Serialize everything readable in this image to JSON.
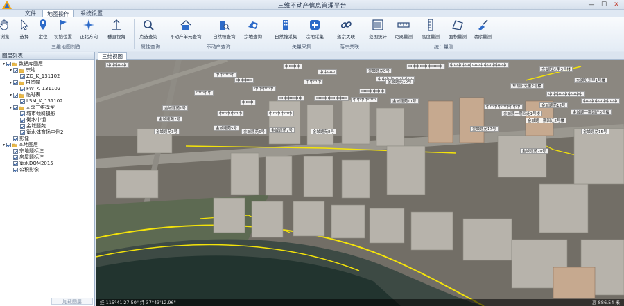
{
  "window": {
    "title": "三维不动产信息管理平台",
    "minimize": "—",
    "maximize": "☐",
    "close": "✕"
  },
  "menu": {
    "tabs": [
      "文件",
      "地图操作",
      "系统设置"
    ],
    "active": 1
  },
  "ribbon": {
    "groups": [
      {
        "label": "三维地图浏览",
        "buttons": [
          "浏览",
          "选择",
          "定位",
          "初始位置",
          "正北方向",
          "垂直视角"
        ]
      },
      {
        "label": "属性查询",
        "buttons": [
          "点选查询"
        ]
      },
      {
        "label": "不动产查询",
        "buttons": [
          "不动产单元查询",
          "自然幢查询",
          "宗地查询"
        ]
      },
      {
        "label": "矢量采集",
        "buttons": [
          "自然幢采集",
          "宗地采集"
        ]
      },
      {
        "label": "落宗关联",
        "buttons": [
          "落宗关联"
        ]
      },
      {
        "label": "统计量测",
        "buttons": [
          "范围统计",
          "距离量测",
          "高度量测",
          "面积量测",
          "清除量测"
        ]
      }
    ],
    "icons": [
      "hand-icon",
      "cursor-arrow-icon",
      "location-pin-icon",
      "flag-icon",
      "compass-icon",
      "vertical-view-icon",
      "magnifier-icon",
      "property-unit-icon",
      "building-search-icon",
      "parcel-search-icon",
      "building-capture-icon",
      "plus-capture-icon",
      "link-icon",
      "range-stat-icon",
      "distance-measure-icon",
      "height-measure-icon",
      "area-measure-icon",
      "clear-measure-icon"
    ]
  },
  "layer_panel": {
    "title": "图层列表",
    "tree": [
      {
        "label": "数据库图层",
        "level": 0,
        "expand": "▾",
        "checked": true,
        "icon": "folder"
      },
      {
        "label": "宗地",
        "level": 1,
        "expand": "▾",
        "checked": true,
        "icon": "folder"
      },
      {
        "label": "ZD_K_131102",
        "level": 2,
        "expand": "",
        "checked": true,
        "icon": ""
      },
      {
        "label": "自然幢",
        "level": 1,
        "expand": "▾",
        "checked": true,
        "icon": "folder"
      },
      {
        "label": "FW_K_131102",
        "level": 2,
        "expand": "",
        "checked": true,
        "icon": ""
      },
      {
        "label": "临时表",
        "level": 1,
        "expand": "▾",
        "checked": true,
        "icon": "folder"
      },
      {
        "label": "LSM_K_131102",
        "level": 2,
        "expand": "",
        "checked": true,
        "icon": ""
      },
      {
        "label": "天享三维模型",
        "level": 1,
        "expand": "▾",
        "checked": true,
        "icon": "folder"
      },
      {
        "label": "城市倾斜摄影",
        "level": 2,
        "expand": "",
        "checked": true,
        "icon": ""
      },
      {
        "label": "衡水中钢",
        "level": 2,
        "expand": "",
        "checked": true,
        "icon": ""
      },
      {
        "label": "金城题苑",
        "level": 2,
        "expand": "",
        "checked": true,
        "icon": ""
      },
      {
        "label": "衡水体育场中例2",
        "level": 2,
        "expand": "",
        "checked": true,
        "icon": ""
      },
      {
        "label": "影像",
        "level": 1,
        "expand": "",
        "checked": true,
        "icon": ""
      },
      {
        "label": "本地图层",
        "level": 0,
        "expand": "▾",
        "checked": true,
        "icon": "folder"
      },
      {
        "label": "宗地题标注",
        "level": 1,
        "expand": "",
        "checked": true,
        "icon": ""
      },
      {
        "label": "房屋题标注",
        "level": 1,
        "expand": "",
        "checked": true,
        "icon": ""
      },
      {
        "label": "衡水DOM2015",
        "level": 1,
        "expand": "",
        "checked": true,
        "icon": ""
      },
      {
        "label": "公积影像",
        "level": 1,
        "expand": "",
        "checked": true,
        "icon": ""
      }
    ],
    "bottom_button": "加载图层"
  },
  "view": {
    "tab": "三维视图",
    "labels": [
      "中中中中中",
      "中中中中",
      "中中中中",
      "中中中中",
      "中中中中",
      "中中中中",
      "中中中中中",
      "中中中中中",
      "中中中",
      "中中中中中中",
      "中中中中中中",
      "中中中中中中",
      "中中中中中中中中",
      "中中中中中中",
      "中中中中中中",
      "中中中中中中中中中",
      "中中中中中中中中中",
      "中中中中中中中中中",
      "东湖阳光里3号楼",
      "东湖阳光里1号楼",
      "东湖阳光里2号楼",
      "中中中中中中中中中",
      "中中中中中中中中中",
      "金城题一期回迁1号楼",
      "金城题一期回迁2号楼",
      "金城题一期回迁3号楼",
      "中中中中中中中中中",
      "中中中中中中中中中",
      "金城题苑1号",
      "金城题苑2号",
      "金城题苑3号",
      "金城题苑5号",
      "金城题苑6号",
      "金城题苑7号",
      "金城题苑8号",
      "金城题苑9号",
      "金城题苑10号",
      "金城题苑11号",
      "金城题苑12号",
      "金城题苑15号",
      "金城题苑17号",
      "金城题苑20号"
    ],
    "status_left": "经 115°41'27.50\" 纬 37°43'12.96\"",
    "status_right": "高 886.54 米"
  },
  "colors": {
    "boundary": "#f4e30a",
    "ribbon_bg": "#eef3f9"
  }
}
